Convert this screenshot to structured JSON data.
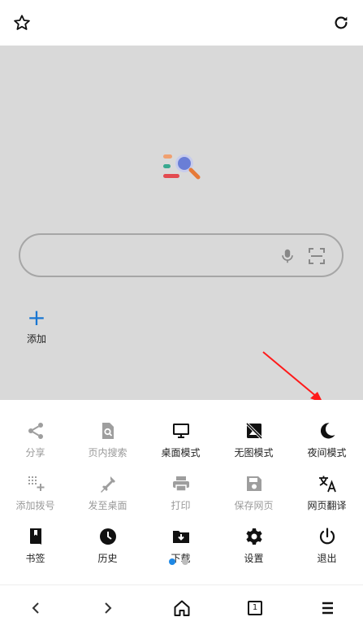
{
  "topbar": {
    "bookmark_icon": "star-outline-icon",
    "refresh_icon": "refresh-icon"
  },
  "search": {
    "placeholder": "",
    "value": "",
    "mic_icon": "microphone-icon",
    "scan_icon": "scan-icon"
  },
  "speed_dial": {
    "add_label": "添加"
  },
  "menu": {
    "row1": [
      {
        "label": "分享",
        "icon": "share-icon",
        "enabled": false
      },
      {
        "label": "页内搜索",
        "icon": "find-in-page-icon",
        "enabled": false
      },
      {
        "label": "桌面模式",
        "icon": "desktop-icon",
        "enabled": true
      },
      {
        "label": "无图模式",
        "icon": "no-image-icon",
        "enabled": true
      },
      {
        "label": "夜间模式",
        "icon": "moon-icon",
        "enabled": true
      }
    ],
    "row2": [
      {
        "label": "添加拨号",
        "icon": "add-dial-icon",
        "enabled": false
      },
      {
        "label": "发至桌面",
        "icon": "send-to-desktop-icon",
        "enabled": false
      },
      {
        "label": "打印",
        "icon": "print-icon",
        "enabled": false
      },
      {
        "label": "保存网页",
        "icon": "save-icon",
        "enabled": false
      },
      {
        "label": "网页翻译",
        "icon": "translate-icon",
        "enabled": true
      }
    ],
    "row3": [
      {
        "label": "书签",
        "icon": "bookmark-icon",
        "enabled": true
      },
      {
        "label": "历史",
        "icon": "history-icon",
        "enabled": true
      },
      {
        "label": "下载",
        "icon": "download-icon",
        "enabled": true
      },
      {
        "label": "设置",
        "icon": "settings-icon",
        "enabled": true
      },
      {
        "label": "退出",
        "icon": "power-icon",
        "enabled": true
      }
    ],
    "page_indicator": {
      "active": 1,
      "total": 2
    }
  },
  "bottombar": {
    "tab_count": "1",
    "icons": [
      "back-icon",
      "forward-icon",
      "home-icon",
      "tabs-icon",
      "menu-icon"
    ]
  },
  "colors": {
    "accent": "#1976d2",
    "annotation_arrow": "#ff1a1a",
    "content_bg": "#d9d9d9",
    "disabled_icon": "#9e9e9e",
    "enabled_icon": "#111111"
  }
}
